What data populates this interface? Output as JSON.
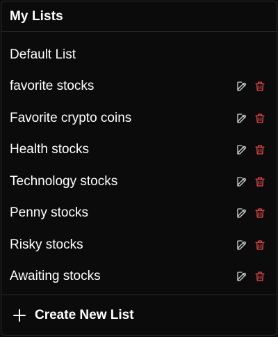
{
  "header": {
    "title": "My Lists"
  },
  "colors": {
    "background": "#0b0b0c",
    "text": "#ffffff",
    "edit_icon": "#cfcfcf",
    "delete_icon": "#e5484d",
    "divider": "#2a2a2c"
  },
  "lists": [
    {
      "label": "Default List",
      "editable": false
    },
    {
      "label": "favorite stocks",
      "editable": true,
      "icons": [
        "edit-icon",
        "trash-icon"
      ]
    },
    {
      "label": "Favorite crypto coins",
      "editable": true,
      "icons": [
        "edit-icon",
        "trash-icon"
      ]
    },
    {
      "label": "Health stocks",
      "editable": true,
      "icons": [
        "edit-icon",
        "trash-icon"
      ]
    },
    {
      "label": "Technology stocks",
      "editable": true,
      "icons": [
        "edit-icon",
        "trash-icon"
      ]
    },
    {
      "label": "Penny stocks",
      "editable": true,
      "icons": [
        "edit-icon",
        "trash-icon"
      ]
    },
    {
      "label": "Risky stocks",
      "editable": true,
      "icons": [
        "edit-icon",
        "trash-icon"
      ]
    },
    {
      "label": "Awaiting stocks",
      "editable": true,
      "icons": [
        "edit-icon",
        "trash-icon"
      ]
    }
  ],
  "footer": {
    "create_label": "Create New List",
    "icon": "plus-icon"
  }
}
